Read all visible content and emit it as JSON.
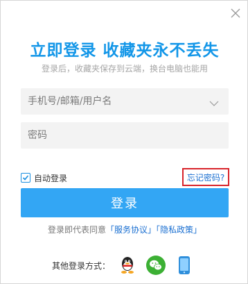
{
  "dialog": {
    "headline": "立即登录 收藏夹永不丢失",
    "subtitle": "登录后，收藏夹保存到云端，换台电脑也能用"
  },
  "form": {
    "account_placeholder": "手机号/邮箱/用户名",
    "password_placeholder": "密码",
    "auto_login_label": "自动登录",
    "auto_login_checked": true,
    "forgot_password": "忘记密码?",
    "login_button": "登录"
  },
  "agreement": {
    "prefix": "登录即代表同意",
    "service": "「服务协议」",
    "privacy": "「隐私政策」"
  },
  "other_login": {
    "label": "其他登录方式：",
    "methods": [
      {
        "icon": "qq-icon"
      },
      {
        "icon": "wechat-icon"
      },
      {
        "icon": "phone-icon"
      }
    ]
  },
  "colors": {
    "accent": "#1296e8",
    "button": "#33a6f4",
    "link": "#1a6fd1",
    "highlight_border": "#d8232a"
  }
}
